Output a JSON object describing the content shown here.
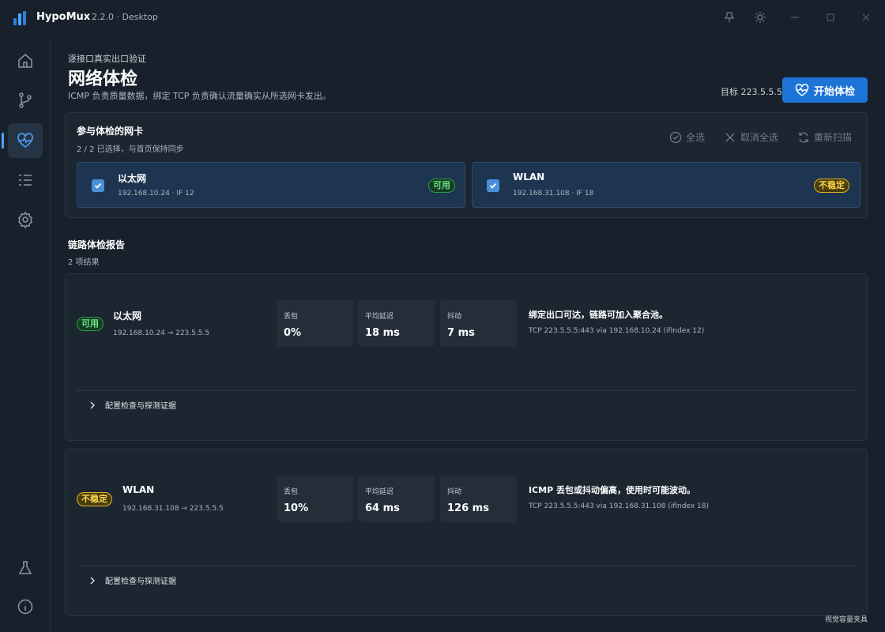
{
  "app": {
    "name": "HypoMux",
    "version": "2.2.0 · Desktop"
  },
  "header": {
    "breadcrumb": "逐接口真实出口验证",
    "title": "网络体检",
    "description": "ICMP 负责质量数据，绑定 TCP 负责确认流量确实从所选网卡发出。",
    "target_label": "目标 223.5.5.5",
    "start_button": "开始体检"
  },
  "nic_panel": {
    "title": "参与体检的网卡",
    "subtitle": "2 / 2 已选择，与首页保持同步",
    "select_all": "全选",
    "deselect_all": "取消全选",
    "rescan": "重新扫描",
    "cards": [
      {
        "name": "以太网",
        "meta": "192.168.10.24 · IF 12",
        "status": "可用"
      },
      {
        "name": "WLAN",
        "meta": "192.168.31.108 · IF 18",
        "status": "不稳定"
      }
    ]
  },
  "report": {
    "title": "链路体检报告",
    "subtitle": "2 项结果",
    "metric_labels": {
      "loss": "丢包",
      "latency": "平均延迟",
      "jitter": "抖动"
    },
    "expander_label": "配置检查与探测证据",
    "items": [
      {
        "status": "可用",
        "name": "以太网",
        "path": "192.168.10.24 → 223.5.5.5",
        "loss": "0%",
        "latency": "18 ms",
        "jitter": "7 ms",
        "verdict": "绑定出口可达，链路可加入聚合池。",
        "detail": "TCP 223.5.5.5:443 via 192.168.10.24 (ifIndex 12)"
      },
      {
        "status": "不稳定",
        "name": "WLAN",
        "path": "192.168.31.108 → 223.5.5.5",
        "loss": "10%",
        "latency": "64 ms",
        "jitter": "126 ms",
        "verdict": "ICMP 丢包或抖动偏高，使用时可能波动。",
        "detail": "TCP 223.5.5.5:443 via 192.168.31.108 (ifIndex 18)"
      }
    ]
  },
  "footer": {
    "note": "视觉容量夹具"
  },
  "colors": {
    "accent": "#1e73d6",
    "ok": "#6ee38a",
    "warn": "#ffd84d"
  },
  "icons": {
    "titlebar": [
      "pin-icon",
      "theme-sun-icon",
      "minimize-icon",
      "maximize-icon",
      "close-icon"
    ],
    "sidebar": [
      "home-icon",
      "branch-icon",
      "heartbeat-icon",
      "list-icon",
      "settings-icon",
      "flask-icon",
      "info-icon"
    ]
  }
}
